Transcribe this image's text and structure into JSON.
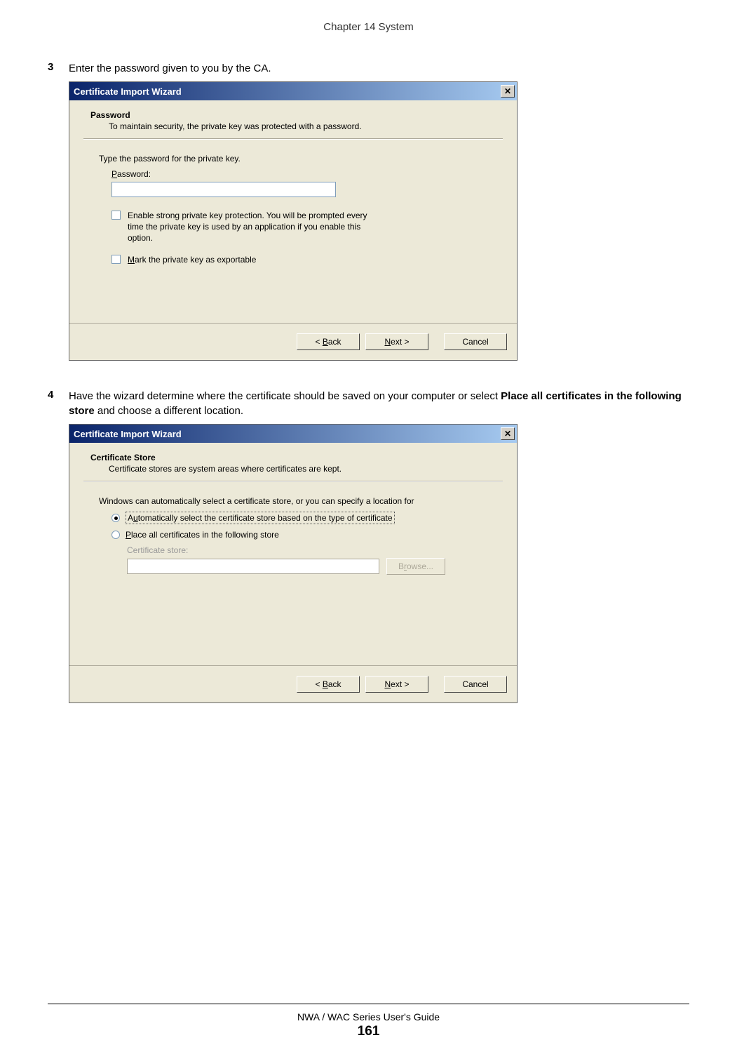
{
  "header": {
    "chapter": "Chapter 14 System"
  },
  "step3": {
    "num": "3",
    "text": "Enter the password given to you by the CA."
  },
  "step4": {
    "num": "4",
    "text_before": "Have the wizard determine where the certificate should be saved on your computer or select ",
    "bold": "Place all certificates in the following store",
    "text_after": " and choose a different location."
  },
  "dialog1": {
    "title": "Certificate Import Wizard",
    "close": "✕",
    "heading": "Password",
    "sub": "To maintain security, the private key was protected with a password.",
    "prompt": "Type the password for the private key.",
    "pw_label_underline": "P",
    "pw_label_rest": "assword:",
    "pw_value": "",
    "chk1": "Enable strong private key protection. You will be prompted every time the private key is used by an application if you enable this option.",
    "chk2_underline": "M",
    "chk2_rest": "ark the private key as exportable",
    "back_lt": "< ",
    "back_underline": "B",
    "back_rest": "ack",
    "next_underline": "N",
    "next_rest": "ext >",
    "cancel": "Cancel"
  },
  "dialog2": {
    "title": "Certificate Import Wizard",
    "close": "✕",
    "heading": "Certificate Store",
    "sub": "Certificate stores are system areas where certificates are kept.",
    "prompt": "Windows can automatically select a certificate store, or you can specify a location for",
    "radio1_a": "A",
    "radio1_underline": "u",
    "radio1_rest": "tomatically select the certificate store based on the type of certificate",
    "radio2_underline": "P",
    "radio2_rest": "lace all certificates in the following store",
    "store_label": "Certificate store:",
    "store_value": "",
    "browse_b": "B",
    "browse_underline": "r",
    "browse_rest": "owse...",
    "back_lt": "< ",
    "back_underline": "B",
    "back_rest": "ack",
    "next_underline": "N",
    "next_rest": "ext >",
    "cancel": "Cancel"
  },
  "footer": {
    "guide": "NWA / WAC Series User's Guide",
    "page": "161"
  }
}
